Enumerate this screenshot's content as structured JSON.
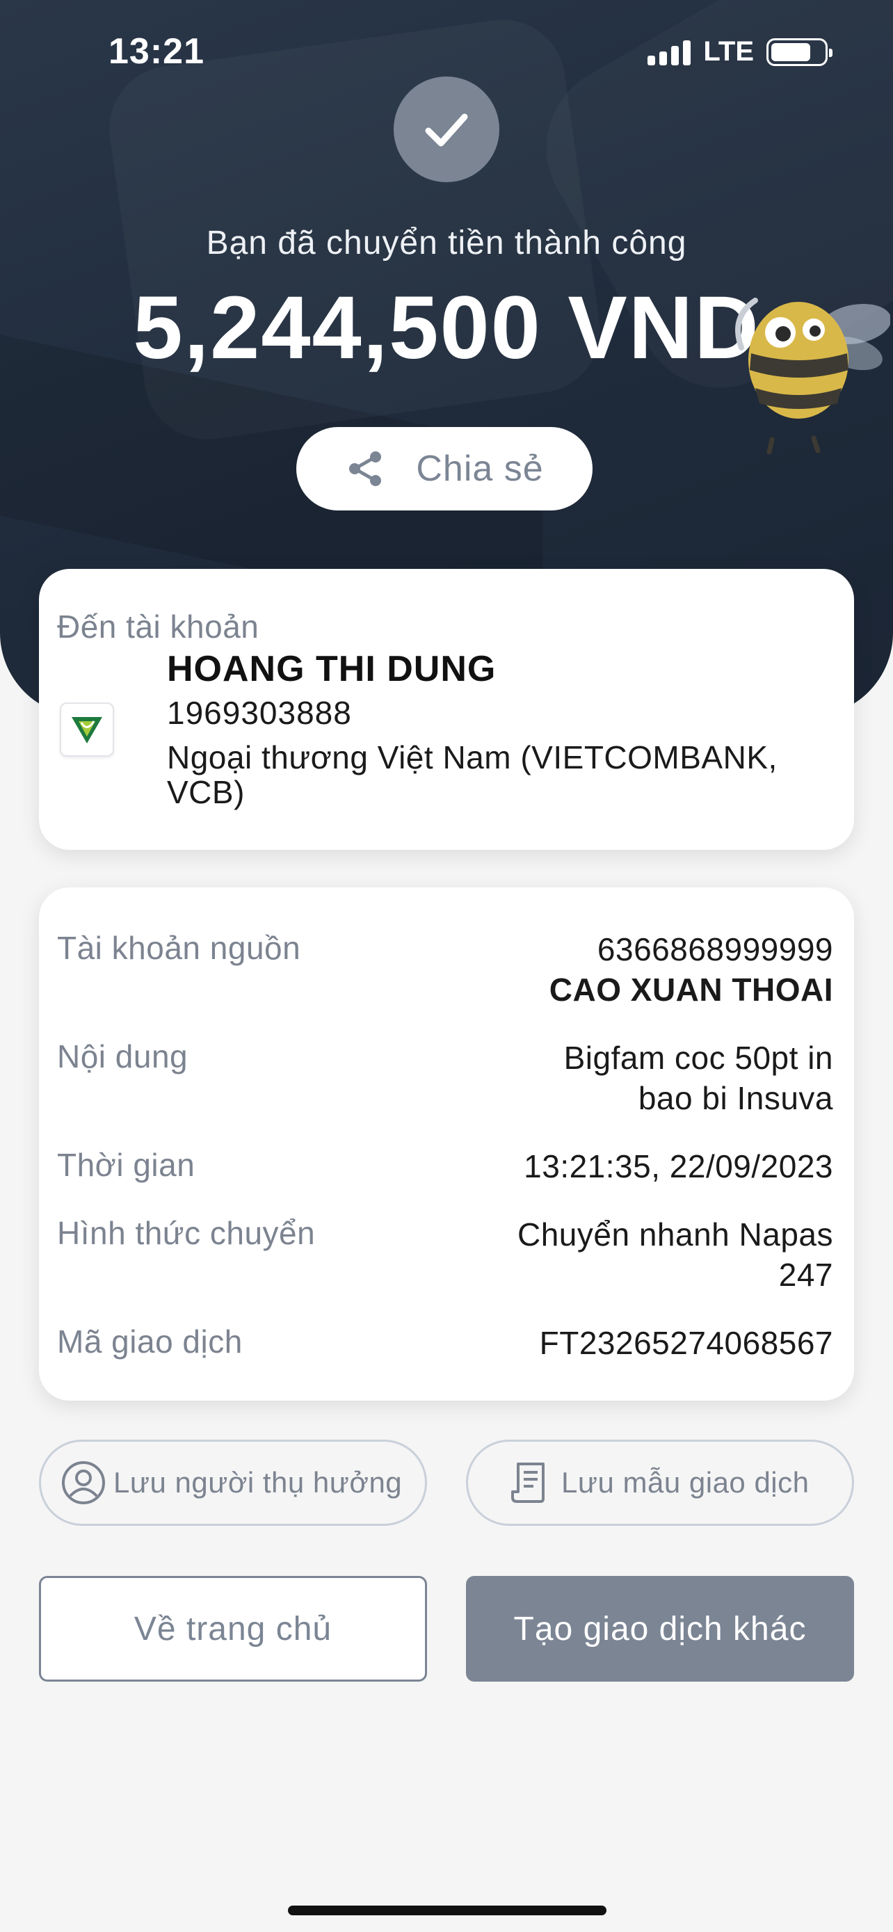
{
  "status_bar": {
    "time": "13:21",
    "network": "LTE"
  },
  "hero": {
    "success_text": "Bạn đã chuyển tiền thành công",
    "amount": "5,244,500 VND",
    "share_label": "Chia sẻ"
  },
  "recipient": {
    "title": "Đến tài khoản",
    "name": "HOANG THI DUNG",
    "account_number": "1969303888",
    "bank": "Ngoại thương Việt Nam (VIETCOMBANK, VCB)"
  },
  "details": {
    "source_label": "Tài khoản nguồn",
    "source_account": "6366868999999",
    "source_name": "CAO XUAN THOAI",
    "content_label": "Nội dung",
    "content_line1": "Bigfam coc 50pt in",
    "content_line2": "bao bi Insuva",
    "time_label": "Thời gian",
    "time_value": "13:21:35, 22/09/2023",
    "method_label": "Hình thức chuyển",
    "method_line1": "Chuyển nhanh Napas",
    "method_line2": "247",
    "txn_label": "Mã giao dịch",
    "txn_value": "FT23265274068567"
  },
  "actions": {
    "save_beneficiary": "Lưu người thụ hưởng",
    "save_template": "Lưu mẫu giao dịch",
    "home": "Về trang chủ",
    "new_transaction": "Tạo giao dịch khác"
  },
  "colors": {
    "hero_bg": "#1f2b3b",
    "accent_grey": "#7b8594",
    "vietcombank_green": "#1d7a3e"
  },
  "icons": [
    "check-icon",
    "share-icon",
    "vietcombank-logo",
    "user-icon",
    "receipt-icon",
    "bee-mascot"
  ]
}
